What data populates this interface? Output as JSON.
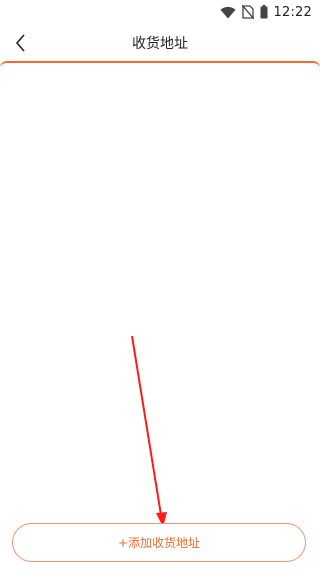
{
  "status_bar": {
    "time": "12:22",
    "icons": [
      "wifi-icon",
      "no-sim-icon",
      "battery-icon"
    ]
  },
  "header": {
    "title": "收货地址",
    "back_icon": "chevron-left-icon"
  },
  "footer": {
    "add_button_label": "+添加收货地址"
  },
  "colors": {
    "accent": "#f26b2f",
    "button_border": "#f5936a",
    "annotation_arrow": "#ff1a1a"
  }
}
